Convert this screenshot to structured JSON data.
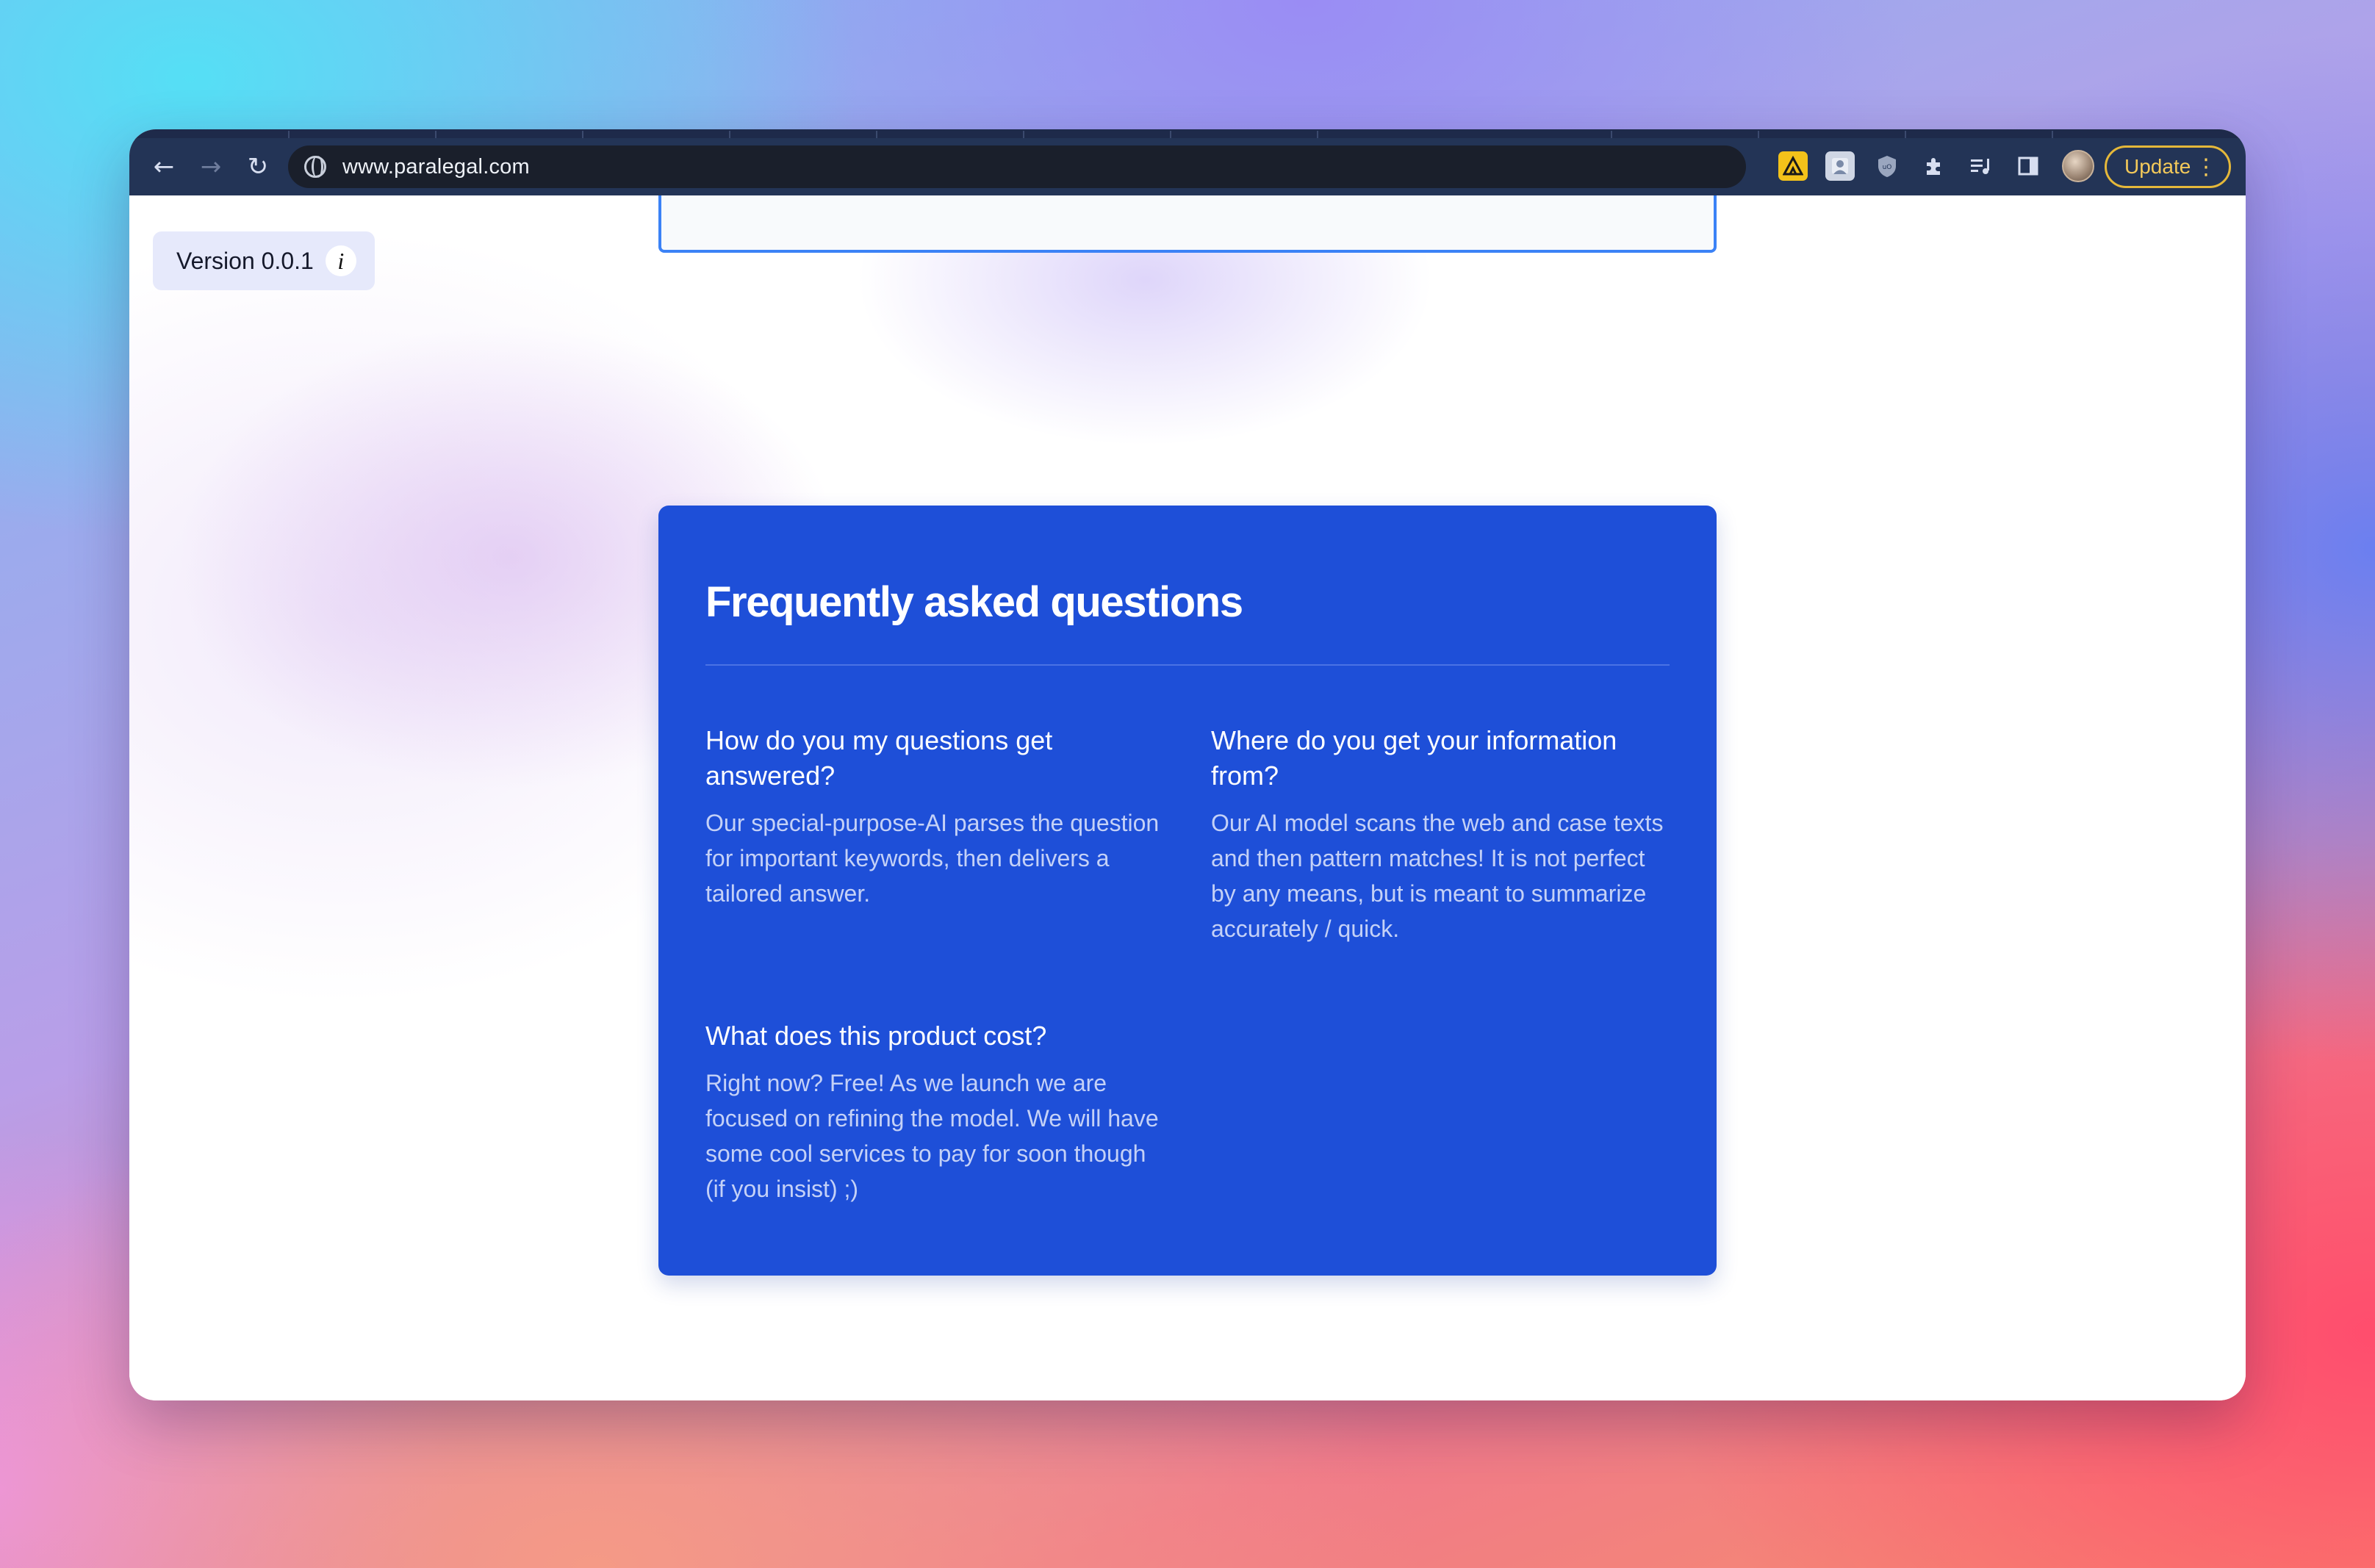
{
  "browser": {
    "url": "www.paralegal.com",
    "update_label": "Update",
    "back_icon": "←",
    "forward_icon": "→",
    "reload_icon": "↻",
    "menu_icon": "⋮"
  },
  "page": {
    "version_label": "Version 0.0.1",
    "info_icon_label": "i"
  },
  "faq": {
    "title": "Frequently asked questions",
    "items": [
      {
        "question": "How do you my questions get answered?",
        "answer": "Our special-purpose-AI parses the question for important keywords, then delivers a tailored answer."
      },
      {
        "question": "Where do you get your information from?",
        "answer": "Our AI model scans the web and case texts and then pattern matches! It is not perfect by any means, but is meant to summarize accurately / quick."
      },
      {
        "question": "What does this product cost?",
        "answer": "Right now? Free! As we launch we are focused on refining the model. We will have some cool services to pay for soon though (if you insist) ;)"
      }
    ]
  },
  "colors": {
    "faq_background": "#1e4fd8",
    "update_accent": "#e5b83a",
    "input_border": "#3b82f6"
  }
}
